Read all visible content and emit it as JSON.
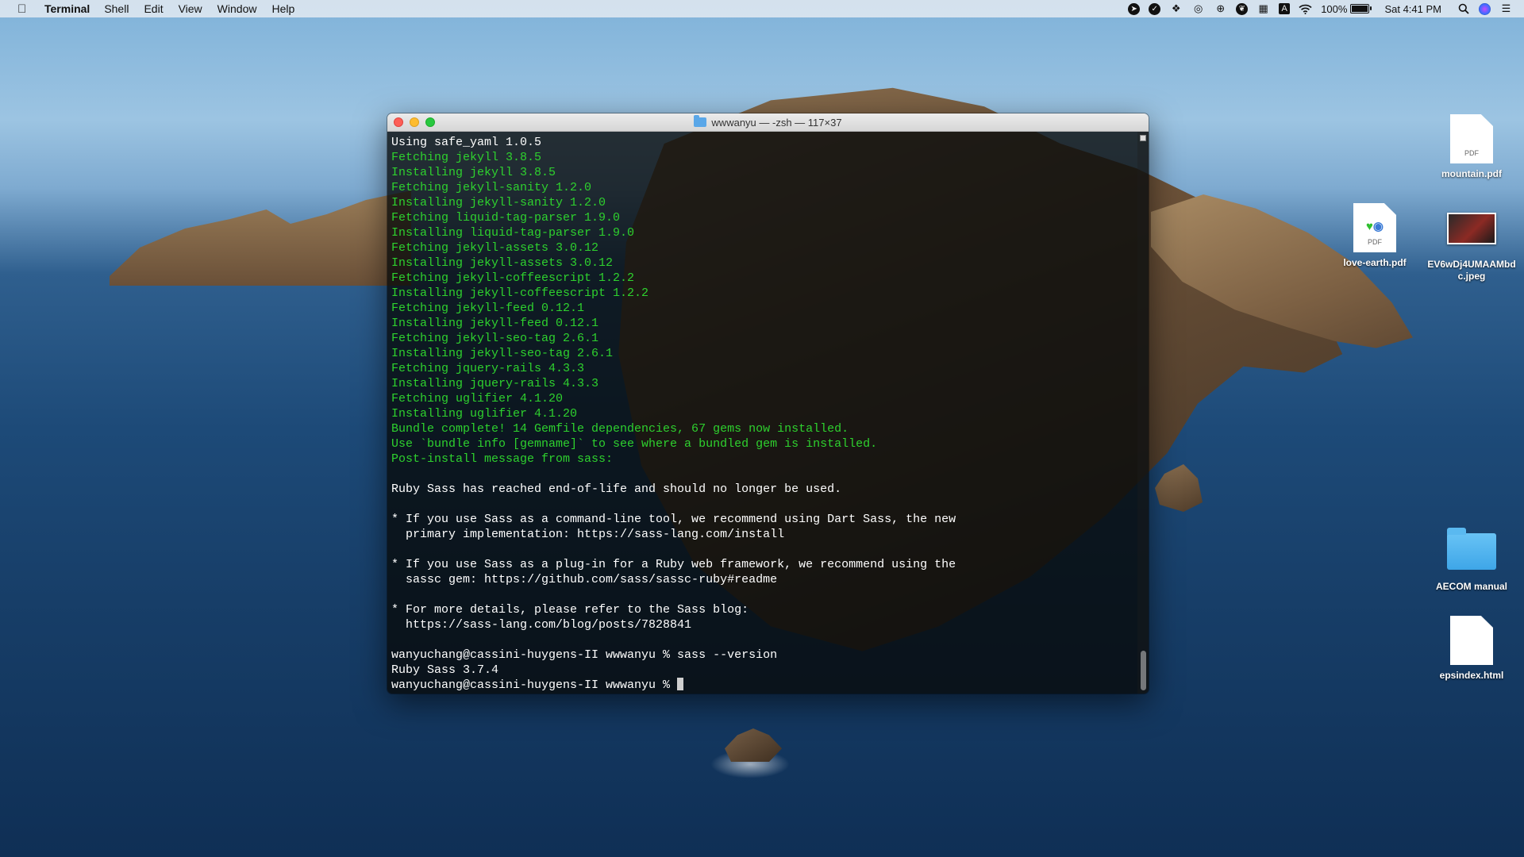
{
  "menubar": {
    "apple_icon": "apple-logo",
    "app_name": "Terminal",
    "menus": [
      "Shell",
      "Edit",
      "View",
      "Window",
      "Help"
    ],
    "status_icons": [
      "location-arrow-icon",
      "checkmark-circle-icon",
      "dropbox-icon",
      "opera-icon",
      "globe-icon",
      "leaf-icon",
      "grid-icon",
      "input-source-icon",
      "wifi-icon"
    ],
    "battery": "100%",
    "clock": "Sat 4:41 PM"
  },
  "window": {
    "title": "wwwanyu — -zsh — 117×37",
    "lines": [
      {
        "text": "Using safe_yaml 1.0.5",
        "color": "white"
      },
      {
        "text": "Fetching jekyll 3.8.5",
        "color": "green"
      },
      {
        "text": "Installing jekyll 3.8.5",
        "color": "green"
      },
      {
        "text": "Fetching jekyll-sanity 1.2.0",
        "color": "green"
      },
      {
        "text": "Installing jekyll-sanity 1.2.0",
        "color": "green"
      },
      {
        "text": "Fetching liquid-tag-parser 1.9.0",
        "color": "green"
      },
      {
        "text": "Installing liquid-tag-parser 1.9.0",
        "color": "green"
      },
      {
        "text": "Fetching jekyll-assets 3.0.12",
        "color": "green"
      },
      {
        "text": "Installing jekyll-assets 3.0.12",
        "color": "green"
      },
      {
        "text": "Fetching jekyll-coffeescript 1.2.2",
        "color": "green"
      },
      {
        "text": "Installing jekyll-coffeescript 1.2.2",
        "color": "green"
      },
      {
        "text": "Fetching jekyll-feed 0.12.1",
        "color": "green"
      },
      {
        "text": "Installing jekyll-feed 0.12.1",
        "color": "green"
      },
      {
        "text": "Fetching jekyll-seo-tag 2.6.1",
        "color": "green"
      },
      {
        "text": "Installing jekyll-seo-tag 2.6.1",
        "color": "green"
      },
      {
        "text": "Fetching jquery-rails 4.3.3",
        "color": "green"
      },
      {
        "text": "Installing jquery-rails 4.3.3",
        "color": "green"
      },
      {
        "text": "Fetching uglifier 4.1.20",
        "color": "green"
      },
      {
        "text": "Installing uglifier 4.1.20",
        "color": "green"
      },
      {
        "text": "Bundle complete! 14 Gemfile dependencies, 67 gems now installed.",
        "color": "green"
      },
      {
        "text": "Use `bundle info [gemname]` to see where a bundled gem is installed.",
        "color": "green"
      },
      {
        "text": "Post-install message from sass:",
        "color": "green"
      },
      {
        "text": "",
        "color": "white"
      },
      {
        "text": "Ruby Sass has reached end-of-life and should no longer be used.",
        "color": "white"
      },
      {
        "text": "",
        "color": "white"
      },
      {
        "text": "* If you use Sass as a command-line tool, we recommend using Dart Sass, the new",
        "color": "white"
      },
      {
        "text": "  primary implementation: https://sass-lang.com/install",
        "color": "white"
      },
      {
        "text": "",
        "color": "white"
      },
      {
        "text": "* If you use Sass as a plug-in for a Ruby web framework, we recommend using the",
        "color": "white"
      },
      {
        "text": "  sassc gem: https://github.com/sass/sassc-ruby#readme",
        "color": "white"
      },
      {
        "text": "",
        "color": "white"
      },
      {
        "text": "* For more details, please refer to the Sass blog:",
        "color": "white"
      },
      {
        "text": "  https://sass-lang.com/blog/posts/7828841",
        "color": "white"
      },
      {
        "text": "",
        "color": "white"
      },
      {
        "text": "wanyuchang@cassini-huygens-II wwwanyu % sass --version",
        "color": "white"
      },
      {
        "text": "Ruby Sass 3.7.4",
        "color": "white"
      }
    ],
    "prompt": "wanyuchang@cassini-huygens-II wwwanyu % "
  },
  "desktop": {
    "icons": [
      {
        "label": "mountain.pdf",
        "kind": "pdf",
        "badge": "PDF"
      },
      {
        "label": "love-earth.pdf",
        "kind": "pdf",
        "badge": "PDF"
      },
      {
        "label": "EV6wDj4UMAAMbdc.jpeg",
        "kind": "jpeg"
      },
      {
        "label": "AECOM manual",
        "kind": "folder"
      },
      {
        "label": "epsindex.html",
        "kind": "html"
      }
    ]
  },
  "colors": {
    "terminal_green": "#2ed12e",
    "terminal_text": "#ffffff",
    "folder_blue": "#3ea6e8"
  }
}
